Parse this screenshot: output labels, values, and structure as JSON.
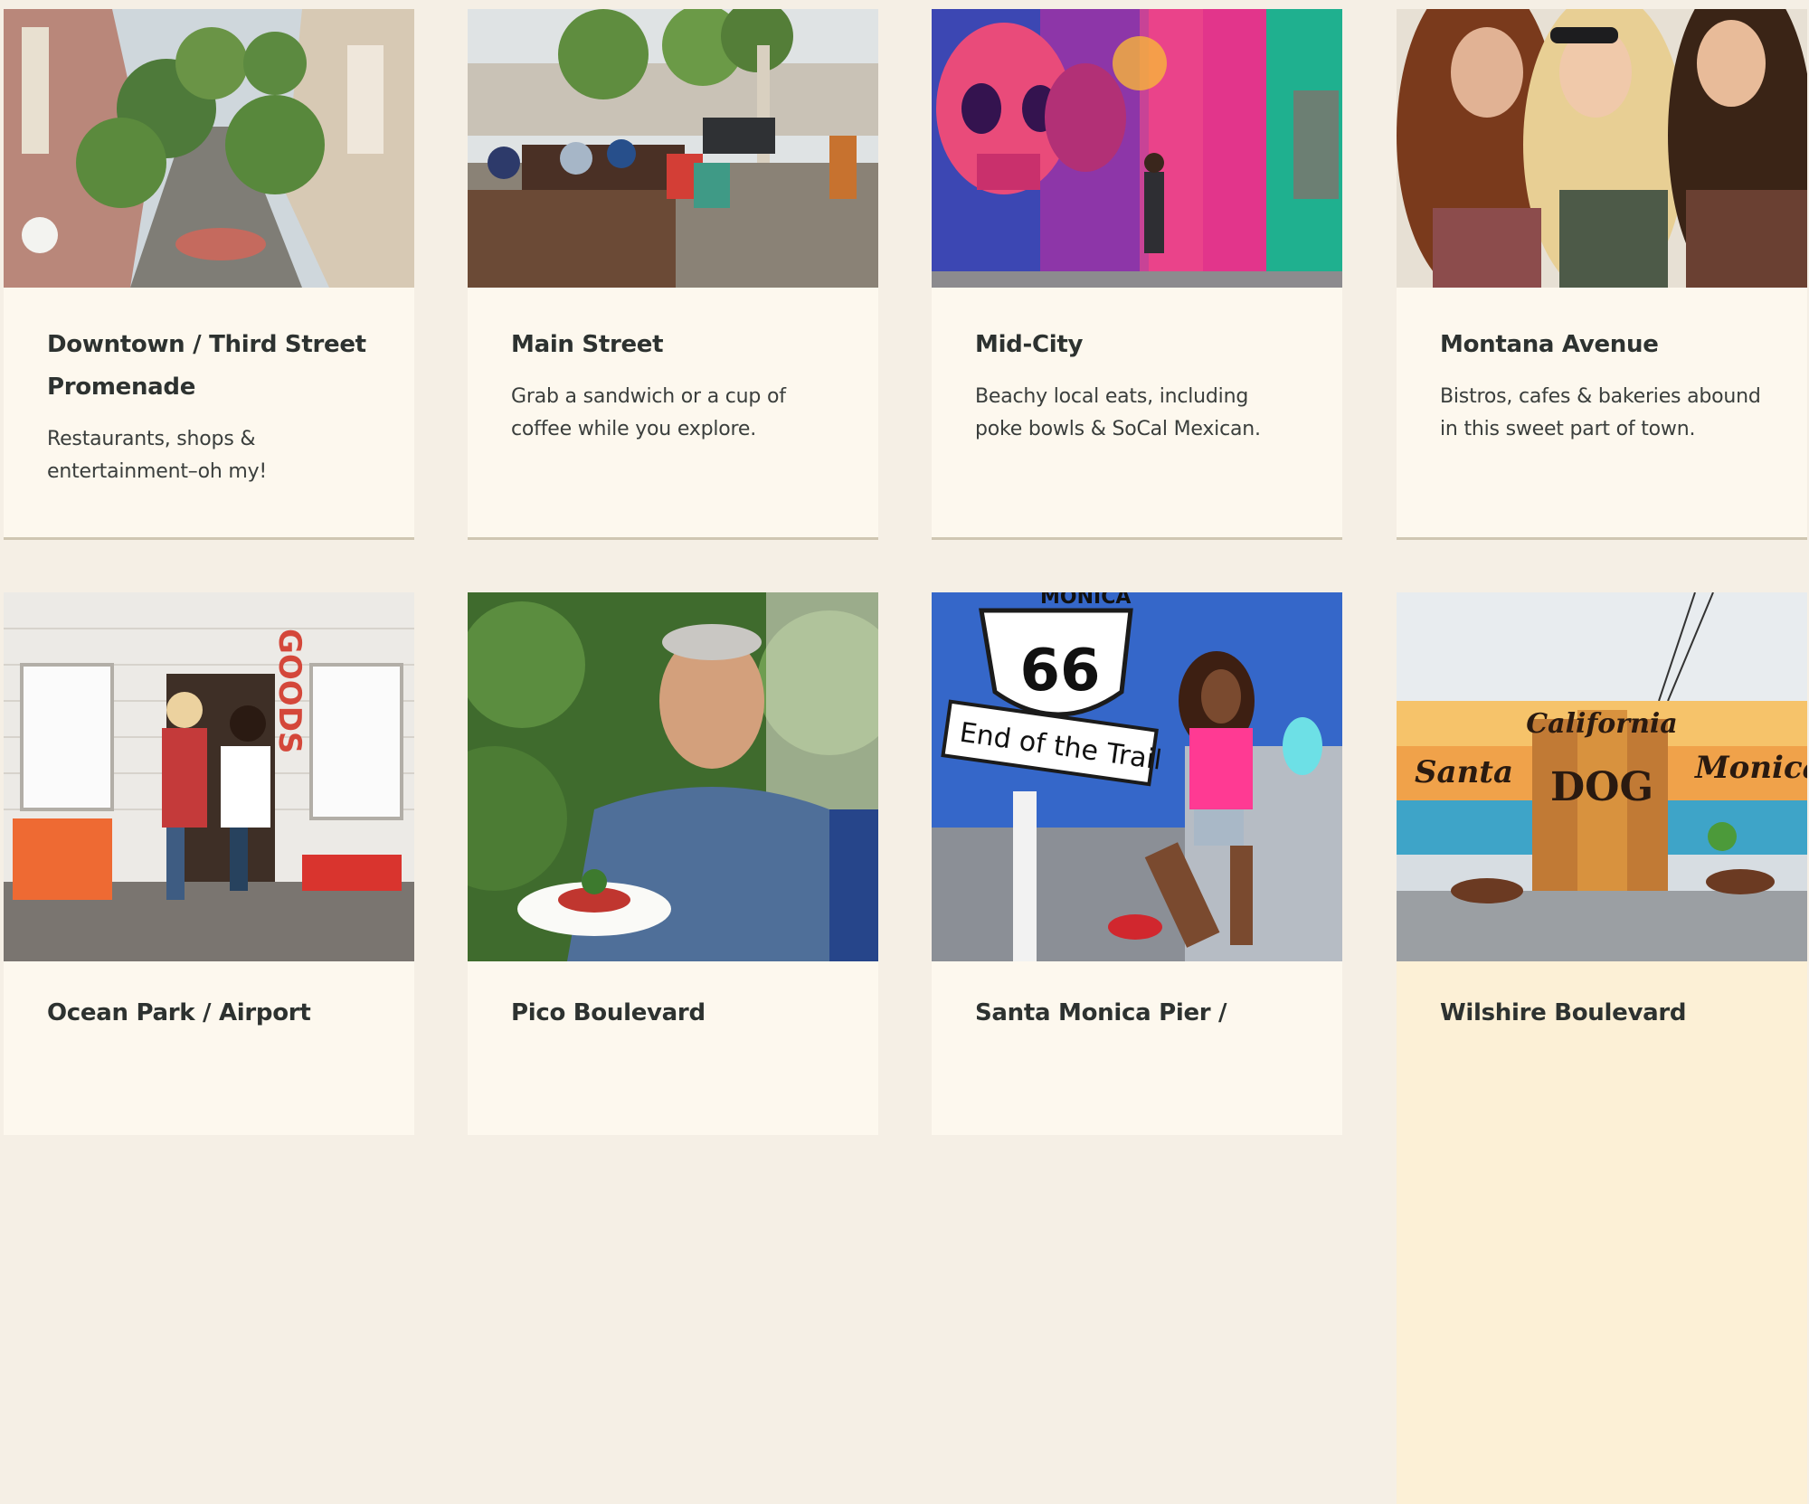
{
  "cards": [
    {
      "title": "Downtown / Third Street Promenade",
      "description": "Restaurants, shops & entertainment–oh my!",
      "image": "street-promenade-photo"
    },
    {
      "title": "Main Street",
      "description": "Grab a sandwich or a cup of coffee while you explore.",
      "image": "sidewalk-cafe-photo"
    },
    {
      "title": "Mid-City",
      "description": "Beachy local eats, including poke bowls & SoCal Mexican.",
      "image": "skull-mural-photo"
    },
    {
      "title": "Montana Avenue",
      "description": "Bistros, cafes & bakeries abound in this sweet part of town.",
      "image": "friends-laughing-photo"
    },
    {
      "title": "Ocean Park / Airport",
      "description": "",
      "image": "goods-storefront-photo"
    },
    {
      "title": "Pico Boulevard",
      "description": "",
      "image": "chef-plate-photo"
    },
    {
      "title": "Santa Monica Pier /",
      "description": "",
      "image": "route66-sign-photo"
    },
    {
      "title": "Wilshire Boulevard",
      "description": "",
      "image": "dogtown-mural-photo"
    }
  ],
  "photo_text": {
    "store_sign": "GOODS",
    "route_number": "66",
    "route_sign": "End of the Trail",
    "route_sign_top": "MONICA",
    "mural_top": "California",
    "mural_left": "Santa",
    "mural_center": "DOG",
    "mural_right": "Monica"
  },
  "colors": {
    "page_background": "#f5efe5",
    "card_background": "#fdf8ee",
    "highlight_card_background": "#fcf0d6",
    "card_border": "#cfc6b2",
    "title_text": "#2d3230"
  }
}
